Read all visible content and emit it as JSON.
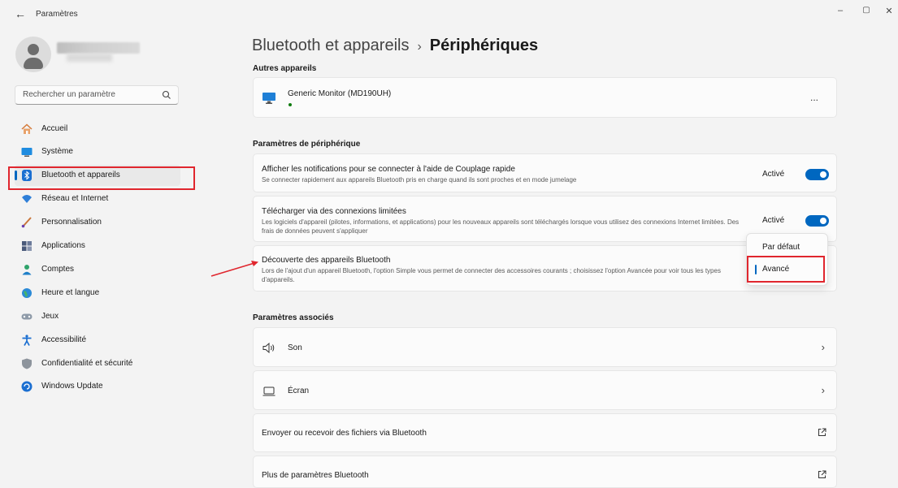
{
  "window": {
    "title": "Paramètres",
    "back_icon": "back-arrow-icon",
    "controls": {
      "minimize": "–",
      "restore": "▢",
      "close": "✕"
    }
  },
  "sidebar": {
    "search": {
      "placeholder": "Rechercher un paramètre",
      "icon": "search-icon"
    },
    "items": [
      {
        "label": "Accueil",
        "icon": "home-icon"
      },
      {
        "label": "Système",
        "icon": "system-icon"
      },
      {
        "label": "Bluetooth et appareils",
        "icon": "bluetooth-icon",
        "selected": true
      },
      {
        "label": "Réseau et Internet",
        "icon": "wifi-icon"
      },
      {
        "label": "Personnalisation",
        "icon": "brush-icon"
      },
      {
        "label": "Applications",
        "icon": "apps-icon"
      },
      {
        "label": "Comptes",
        "icon": "account-icon"
      },
      {
        "label": "Heure et langue",
        "icon": "globe-clock-icon"
      },
      {
        "label": "Jeux",
        "icon": "gamepad-icon"
      },
      {
        "label": "Accessibilité",
        "icon": "accessibility-icon"
      },
      {
        "label": "Confidentialité et sécurité",
        "icon": "shield-icon"
      },
      {
        "label": "Windows Update",
        "icon": "update-icon"
      }
    ]
  },
  "header": {
    "parent": "Bluetooth et appareils",
    "separator": "›",
    "current": "Périphériques"
  },
  "other_devices": {
    "title": "Autres appareils",
    "devices": [
      {
        "name": "Generic Monitor (MD190UH)",
        "icon": "monitor-icon",
        "more": "..."
      }
    ]
  },
  "device_settings": {
    "title": "Paramètres de périphérique",
    "swift_pair": {
      "title": "Afficher les notifications pour se connecter à l'aide de Couplage rapide",
      "desc": "Se connecter rapidement aux appareils Bluetooth pris en charge quand ils sont proches et en mode jumelage",
      "state": "Activé",
      "on": true
    },
    "metered": {
      "title": "Télécharger via des connexions limitées",
      "desc": "Les logiciels d'appareil (pilotes, informations, et applications) pour les nouveaux appareils sont téléchargés lorsque vous utilisez des connexions Internet limitées. Des frais de données peuvent s'appliquer",
      "state": "Activé",
      "on": true
    },
    "discovery": {
      "title": "Découverte des appareils Bluetooth",
      "desc": "Lors de l'ajout d'un appareil Bluetooth, l'option Simple vous permet de connecter des accessoires courants ; choisissez l'option Avancée pour voir tous les types d'appareils.",
      "options": [
        "Par défaut",
        "Avancé"
      ],
      "selected": "Avancé"
    }
  },
  "related": {
    "title": "Paramètres associés",
    "items": [
      {
        "label": "Son",
        "icon": "speaker-icon",
        "trailing": "›"
      },
      {
        "label": "Écran",
        "icon": "screen-icon",
        "trailing": "›"
      },
      {
        "label": "Envoyer ou recevoir des fichiers via Bluetooth",
        "trailing_icon": "external-link-icon"
      },
      {
        "label": "Plus de paramètres Bluetooth",
        "trailing_icon": "external-link-icon"
      }
    ]
  },
  "colors": {
    "accent": "#0067c0",
    "annotation": "#e0262e",
    "background": "#f3f3f3",
    "card": "#fbfbfb"
  }
}
